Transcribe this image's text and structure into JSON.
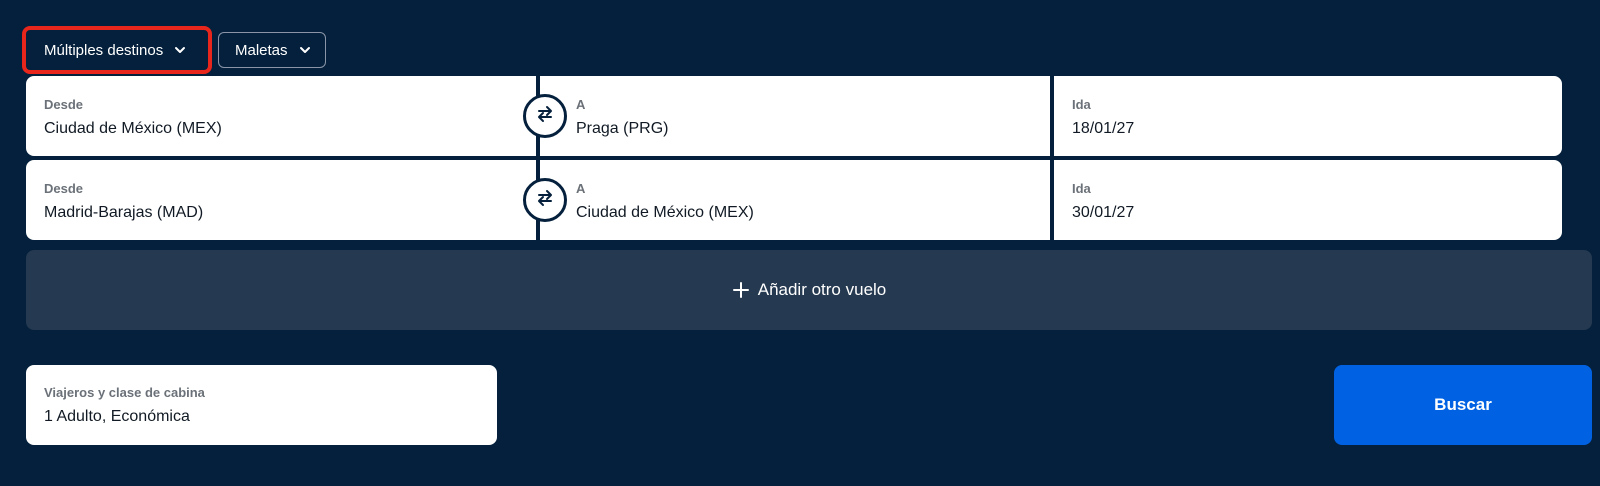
{
  "trip_type": {
    "label": "Múltiples destinos",
    "icon": "chevron-down-icon",
    "highlight_color": "#e8261c"
  },
  "bags": {
    "label": "Maletas",
    "icon": "chevron-down-icon"
  },
  "flights": [
    {
      "from_label": "Desde",
      "from_value": "Ciudad de México (MEX)",
      "to_label": "A",
      "to_value": "Praga (PRG)",
      "date_label": "Ida",
      "date_value": "18/01/27",
      "swap_icon": "swap-arrows-icon"
    },
    {
      "from_label": "Desde",
      "from_value": "Madrid-Barajas (MAD)",
      "to_label": "A",
      "to_value": "Ciudad de México (MEX)",
      "date_label": "Ida",
      "date_value": "30/01/27",
      "swap_icon": "swap-arrows-icon"
    }
  ],
  "add_flight": {
    "label": "Añadir otro vuelo",
    "icon": "plus-icon"
  },
  "travellers": {
    "label": "Viajeros y clase de cabina",
    "value": "1 Adulto, Económica"
  },
  "search": {
    "label": "Buscar",
    "color": "#0062e3"
  },
  "colors": {
    "background": "#05203c",
    "add_flight_bg": "#253950"
  }
}
